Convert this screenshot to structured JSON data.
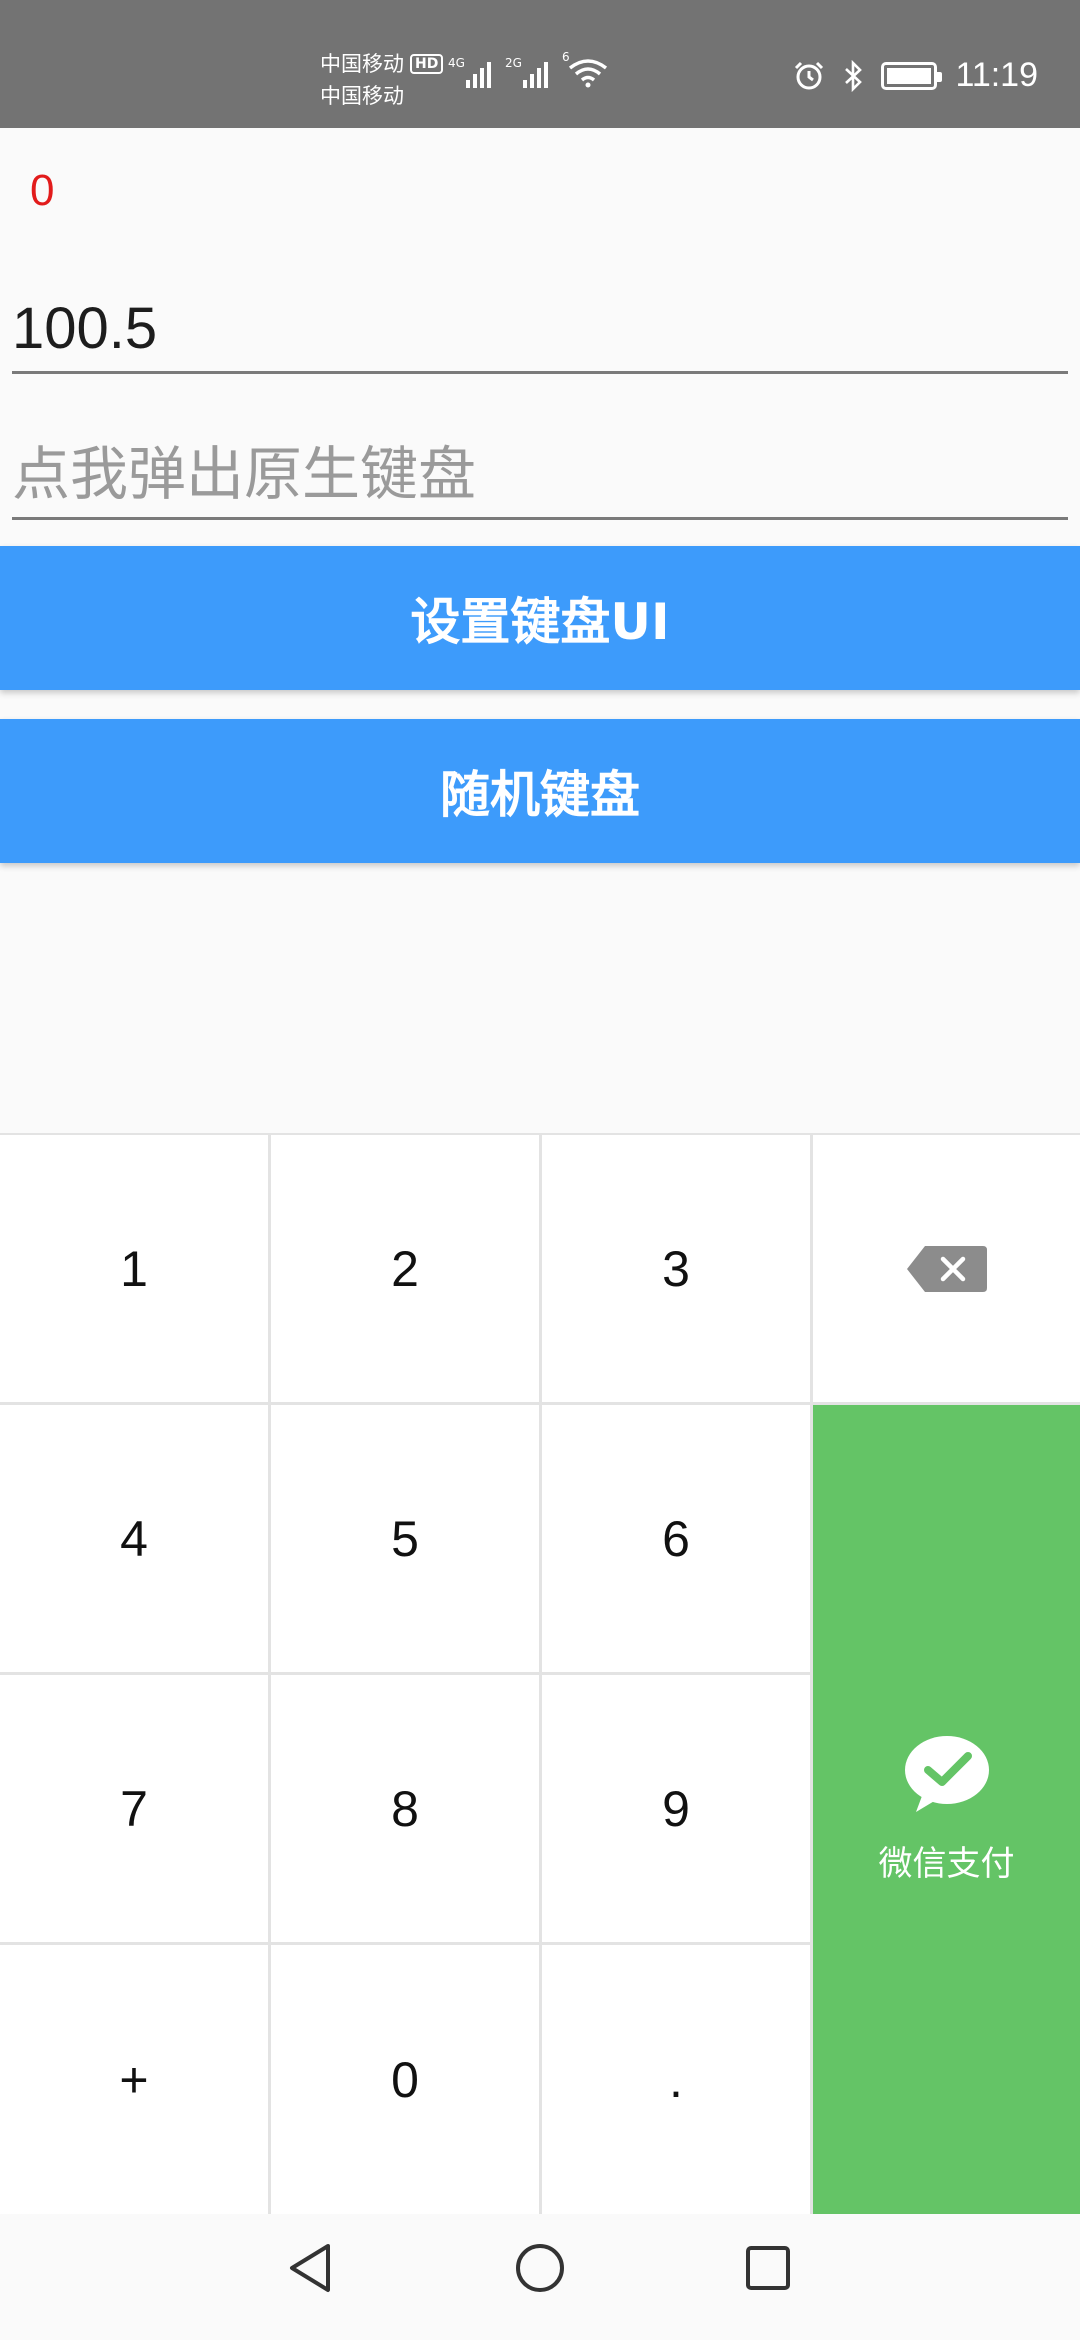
{
  "status_bar": {
    "carrier_1": "中国移动",
    "carrier_2": "中国移动",
    "hd": "HD",
    "net_1": "4G",
    "net_2": "2G",
    "wifi_tag": "6",
    "time": "11:19"
  },
  "counter": "0",
  "amount_field": {
    "value": "100.5"
  },
  "native_field": {
    "placeholder": "点我弹出原生键盘"
  },
  "buttons": {
    "set_keyboard_ui": "设置键盘UI",
    "random_keyboard": "随机键盘"
  },
  "keyboard": {
    "keys": [
      "1",
      "2",
      "3",
      "4",
      "5",
      "6",
      "7",
      "8",
      "9",
      "+",
      "0",
      "."
    ],
    "backspace_icon": "backspace-icon",
    "pay_label": "微信支付",
    "pay_color": "#64c466"
  },
  "colors": {
    "accent": "#3d9bfb",
    "counter": "#e21b1b",
    "status_bar": "#737373"
  }
}
